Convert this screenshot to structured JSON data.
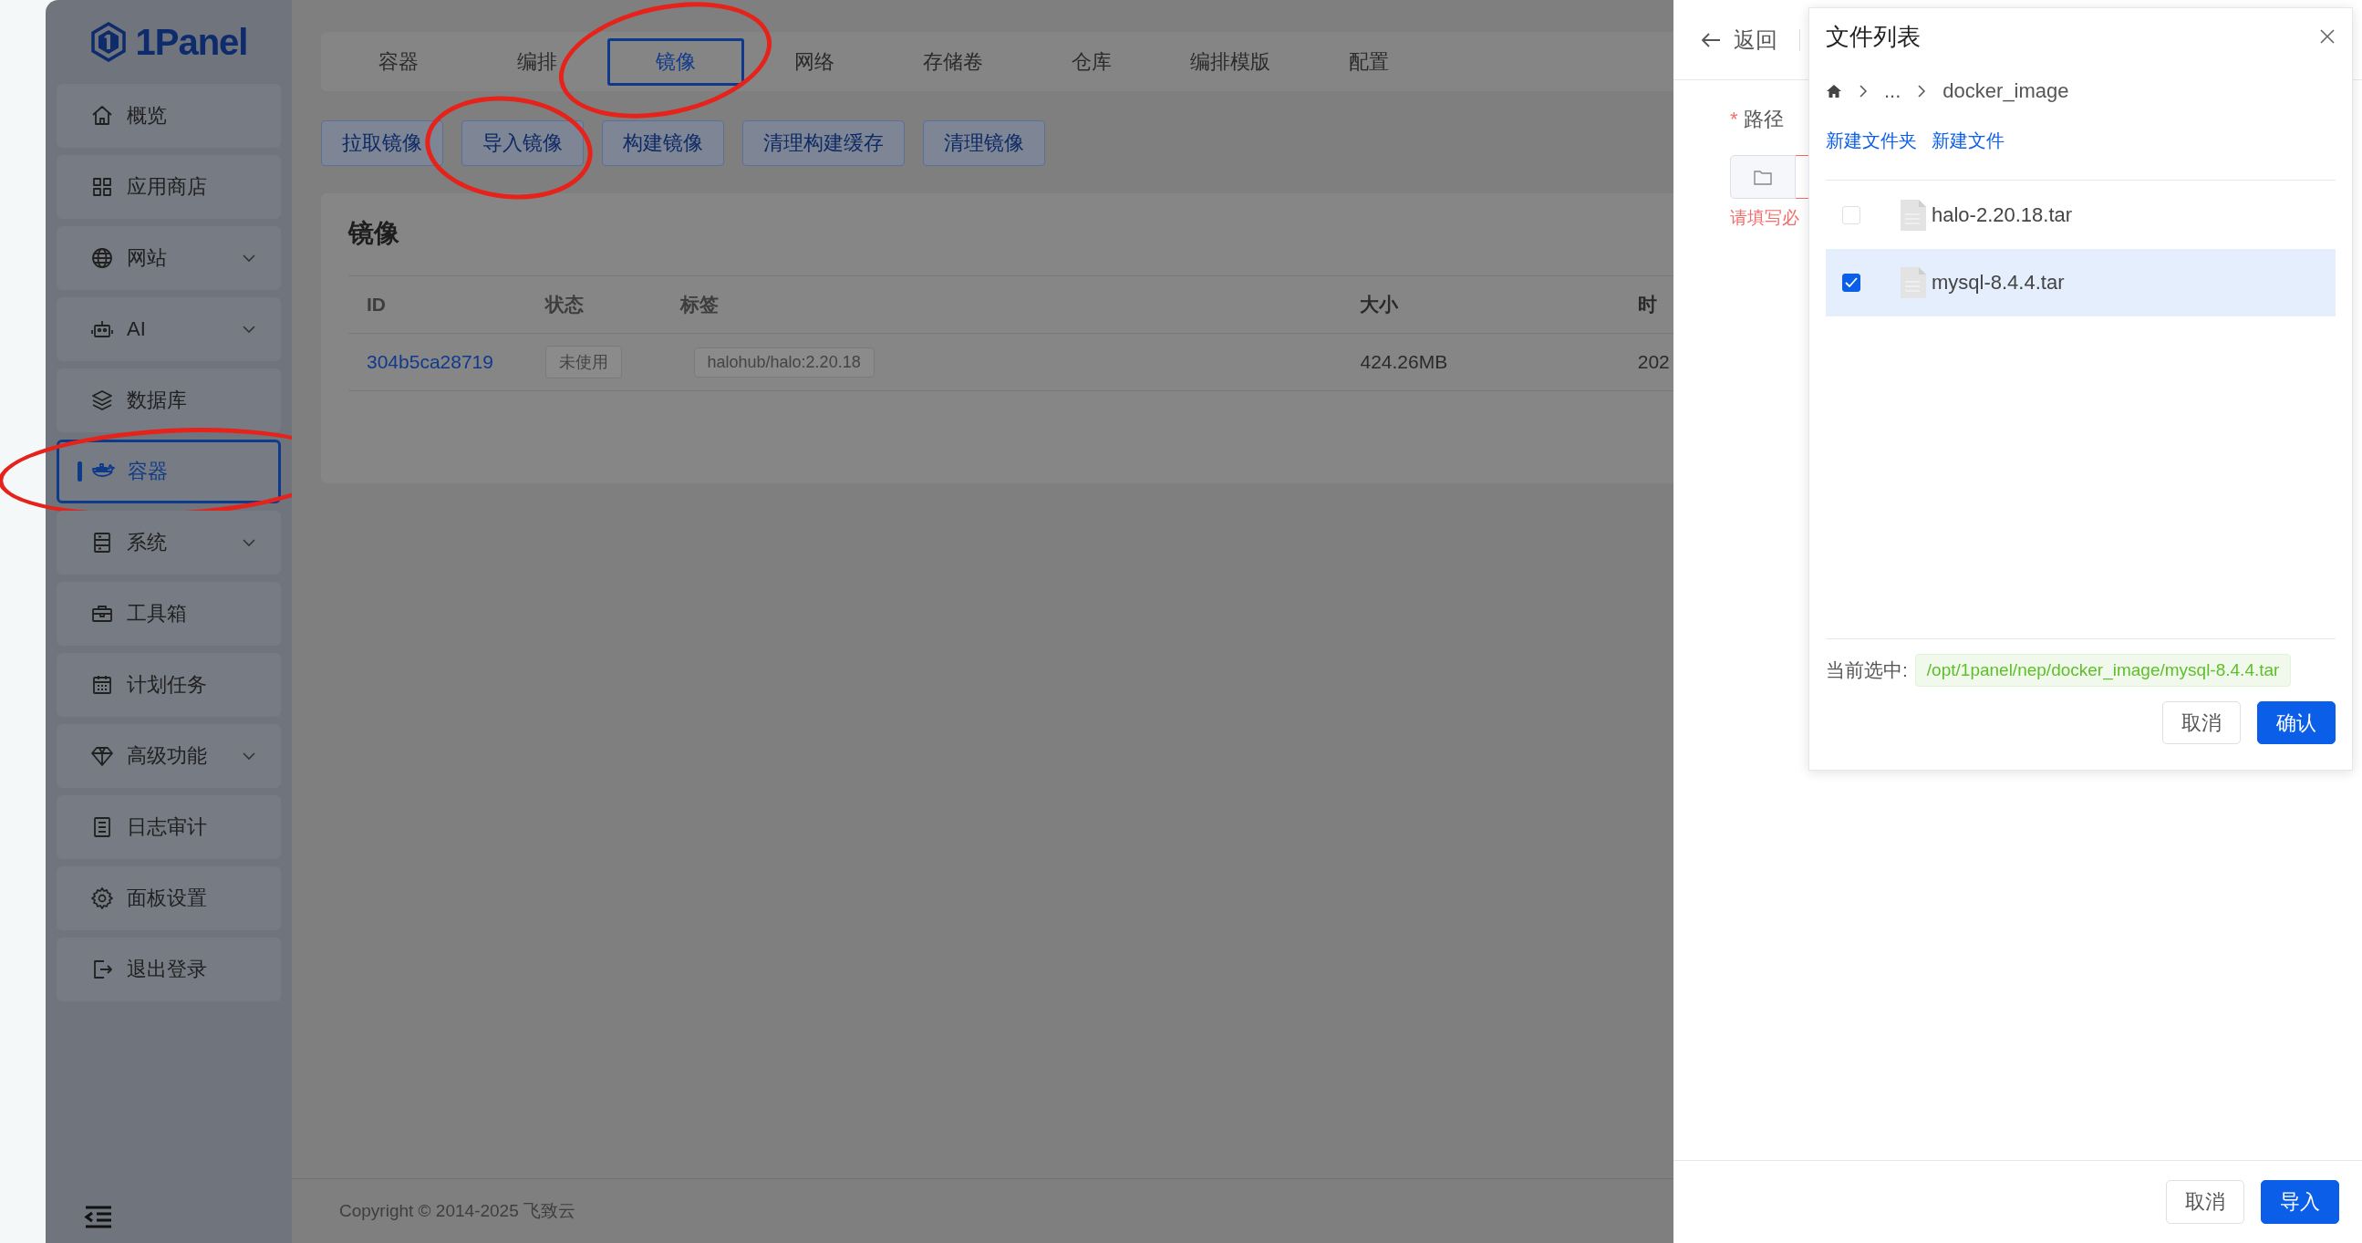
{
  "sidebar": {
    "logo": "1Panel",
    "items": [
      {
        "label": "概览",
        "expandable": false,
        "selected": false,
        "circled": false
      },
      {
        "label": "应用商店",
        "expandable": false,
        "selected": false,
        "circled": false
      },
      {
        "label": "网站",
        "expandable": true,
        "selected": false,
        "circled": false
      },
      {
        "label": "AI",
        "expandable": true,
        "selected": false,
        "circled": false
      },
      {
        "label": "数据库",
        "expandable": false,
        "selected": false,
        "circled": false
      },
      {
        "label": "容器",
        "expandable": false,
        "selected": true,
        "circled": true
      },
      {
        "label": "系统",
        "expandable": true,
        "selected": false,
        "circled": false
      },
      {
        "label": "工具箱",
        "expandable": false,
        "selected": false,
        "circled": false
      },
      {
        "label": "计划任务",
        "expandable": false,
        "selected": false,
        "circled": false
      },
      {
        "label": "高级功能",
        "expandable": true,
        "selected": false,
        "circled": false
      },
      {
        "label": "日志审计",
        "expandable": false,
        "selected": false,
        "circled": false
      },
      {
        "label": "面板设置",
        "expandable": false,
        "selected": false,
        "circled": false
      },
      {
        "label": "退出登录",
        "expandable": false,
        "selected": false,
        "circled": false
      }
    ]
  },
  "tabs": [
    {
      "label": "容器",
      "selected": false,
      "circled": false
    },
    {
      "label": "编排",
      "selected": false,
      "circled": false
    },
    {
      "label": "镜像",
      "selected": true,
      "circled": true
    },
    {
      "label": "网络",
      "selected": false,
      "circled": false
    },
    {
      "label": "存储卷",
      "selected": false,
      "circled": false
    },
    {
      "label": "仓库",
      "selected": false,
      "circled": false
    },
    {
      "label": "编排模版",
      "selected": false,
      "circled": false
    },
    {
      "label": "配置",
      "selected": false,
      "circled": false
    }
  ],
  "actions": [
    {
      "label": "拉取镜像",
      "circled": false
    },
    {
      "label": "导入镜像",
      "circled": true
    },
    {
      "label": "构建镜像",
      "circled": false
    },
    {
      "label": "清理构建缓存",
      "circled": false
    },
    {
      "label": "清理镜像",
      "circled": false
    }
  ],
  "images_card": {
    "title": "镜像",
    "columns": [
      "ID",
      "状态",
      "标签",
      "大小",
      "时"
    ],
    "rows": [
      {
        "id": "304b5ca28719",
        "status": "未使用",
        "tag": "halohub/halo:2.20.18",
        "size": "424.26MB",
        "time": "202"
      }
    ]
  },
  "footer": "Copyright © 2014-2025 飞致云",
  "import_drawer": {
    "back": "返回",
    "required_mark": "*",
    "path_label": "路径",
    "error": "请填写必",
    "buttons": [
      {
        "label": "取消",
        "kind": "default"
      },
      {
        "label": "导入",
        "kind": "primary"
      }
    ]
  },
  "file_picker": {
    "title": "文件列表",
    "breadcrumb": [
      "...",
      "docker_image"
    ],
    "links": [
      "新建文件夹",
      "新建文件"
    ],
    "files": [
      {
        "name": "halo-2.20.18.tar",
        "checked": false
      },
      {
        "name": "mysql-8.4.4.tar",
        "checked": true
      }
    ],
    "current_label": "当前选中:",
    "current_path": "/opt/1panel/nep/docker_image/mysql-8.4.4.tar",
    "buttons": [
      {
        "label": "取消",
        "kind": "default"
      },
      {
        "label": "确认",
        "kind": "primary"
      }
    ]
  }
}
